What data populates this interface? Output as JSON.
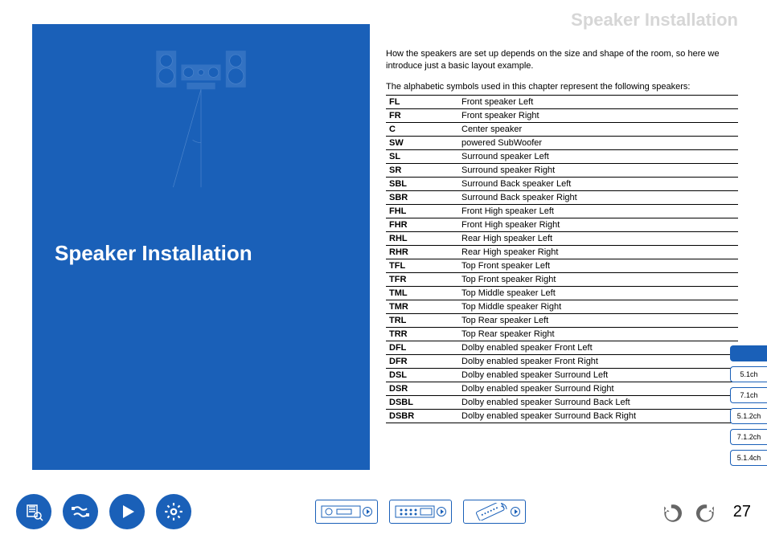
{
  "header": {
    "title": "Speaker Installation"
  },
  "panel": {
    "heading": "Speaker Installation"
  },
  "intro": {
    "p1": "How the speakers are set up depends on the size and shape of the room, so here we introduce just a basic layout example.",
    "p2": "The alphabetic symbols used in this chapter represent the following speakers:"
  },
  "speakers": [
    {
      "code": "FL",
      "name": "Front speaker Left"
    },
    {
      "code": "FR",
      "name": "Front speaker Right"
    },
    {
      "code": "C",
      "name": "Center speaker"
    },
    {
      "code": "SW",
      "name": "powered SubWoofer"
    },
    {
      "code": "SL",
      "name": "Surround speaker Left"
    },
    {
      "code": "SR",
      "name": "Surround speaker Right"
    },
    {
      "code": "SBL",
      "name": "Surround Back speaker Left"
    },
    {
      "code": "SBR",
      "name": "Surround Back speaker Right"
    },
    {
      "code": "FHL",
      "name": "Front High speaker Left"
    },
    {
      "code": "FHR",
      "name": "Front High speaker Right"
    },
    {
      "code": "RHL",
      "name": "Rear High speaker Left"
    },
    {
      "code": "RHR",
      "name": "Rear High speaker Right"
    },
    {
      "code": "TFL",
      "name": "Top Front speaker Left"
    },
    {
      "code": "TFR",
      "name": "Top Front speaker Right"
    },
    {
      "code": "TML",
      "name": "Top Middle speaker Left"
    },
    {
      "code": "TMR",
      "name": "Top Middle speaker Right"
    },
    {
      "code": "TRL",
      "name": "Top Rear speaker Left"
    },
    {
      "code": "TRR",
      "name": "Top Rear speaker Right"
    },
    {
      "code": "DFL",
      "name": "Dolby enabled speaker Front Left"
    },
    {
      "code": "DFR",
      "name": "Dolby enabled speaker Front Right"
    },
    {
      "code": "DSL",
      "name": "Dolby enabled speaker Surround Left"
    },
    {
      "code": "DSR",
      "name": "Dolby enabled speaker Surround Right"
    },
    {
      "code": "DSBL",
      "name": "Dolby enabled speaker Surround Back Left"
    },
    {
      "code": "DSBR",
      "name": "Dolby enabled speaker Surround Back Right"
    }
  ],
  "ch_tabs": [
    {
      "label": "",
      "active": true
    },
    {
      "label": "5.1ch",
      "active": false
    },
    {
      "label": "7.1ch",
      "active": false
    },
    {
      "label": "5.1.2ch",
      "active": false
    },
    {
      "label": "7.1.2ch",
      "active": false
    },
    {
      "label": "5.1.4ch",
      "active": false
    }
  ],
  "page_number": "27",
  "icons": {
    "manual": "manual-icon",
    "cables": "cables-icon",
    "play": "play-icon",
    "settings": "settings-icon",
    "receiver_front": "receiver-front-icon",
    "receiver_back": "receiver-back-icon",
    "remote": "remote-icon",
    "prev": "prev-icon",
    "next": "next-icon"
  }
}
